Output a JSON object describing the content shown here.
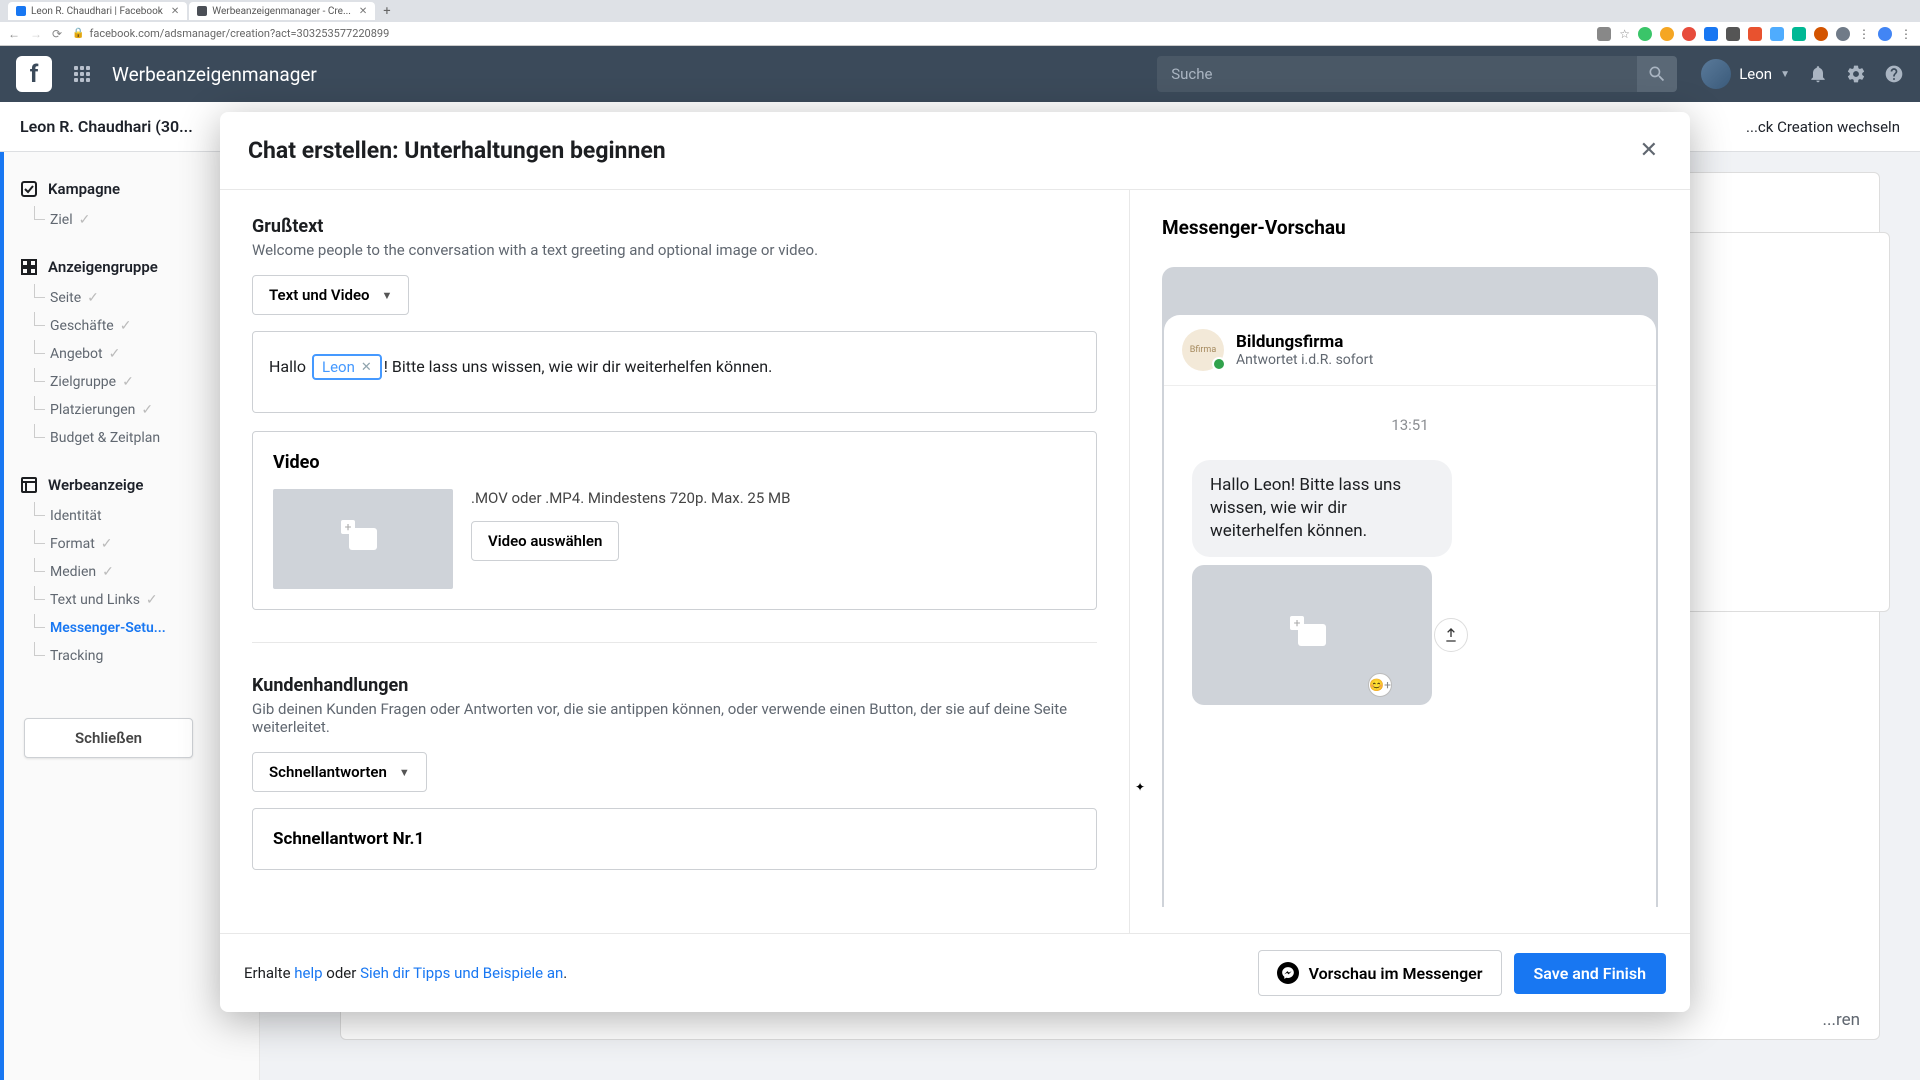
{
  "browser": {
    "tabs": [
      {
        "title": "Leon R. Chaudhari | Facebook"
      },
      {
        "title": "Werbeanzeigenmanager - Cre..."
      }
    ],
    "url": "facebook.com/adsmanager/creation?act=303253577220899"
  },
  "topnav": {
    "title": "Werbeanzeigenmanager",
    "search_placeholder": "Suche",
    "user": "Leon"
  },
  "subheader": {
    "account": "Leon R. Chaudhari (30...",
    "right": "...ck Creation wechseln"
  },
  "sidebar": {
    "campaign": "Kampagne",
    "campaign_items": [
      "Ziel"
    ],
    "adset": "Anzeigengruppe",
    "adset_items": [
      "Seite",
      "Geschäfte",
      "Angebot",
      "Zielgruppe",
      "Platzierungen",
      "Budget & Zeitplan"
    ],
    "ad": "Werbeanzeige",
    "ad_items": [
      "Identität",
      "Format",
      "Medien",
      "Text und Links",
      "Messenger-Setu...",
      "Tracking"
    ],
    "active_index": 4,
    "close": "Schließen"
  },
  "bg": {
    "publish_hint": "...ren"
  },
  "modal": {
    "title": "Chat erstellen: Unterhaltungen beginnen",
    "greeting": {
      "label": "Grußtext",
      "desc": "Welcome people to the conversation with a text greeting and optional image or video.",
      "dropdown": "Text und Video",
      "text_before": "Hallo ",
      "token": "Leon",
      "text_after": "! Bitte lass uns wissen, wie wir dir weiterhelfen können."
    },
    "video": {
      "label": "Video",
      "hint": ".MOV oder .MP4. Mindestens 720p. Max. 25 MB",
      "button": "Video auswählen"
    },
    "actions": {
      "label": "Kundenhandlungen",
      "desc": "Gib deinen Kunden Fragen oder Antworten vor, die sie antippen können, oder verwende einen Button, der sie auf deine Seite weiterleitet.",
      "dropdown": "Schnellantworten",
      "quick_title": "Schnellantwort Nr.1"
    },
    "preview": {
      "title": "Messenger-Vorschau",
      "page_name": "Bildungsfirma",
      "page_sub": "Antwortet i.d.R. sofort",
      "time": "13:51",
      "bubble": "Hallo Leon! Bitte lass uns wissen, wie wir dir weiterhelfen können."
    },
    "footer": {
      "prefix": "Erhalte ",
      "help": "help",
      "mid": " oder ",
      "tips": "Sieh dir Tipps und Beispiele an",
      "suffix": ".",
      "preview_btn": "Vorschau im Messenger",
      "save_btn": "Save and Finish"
    }
  }
}
